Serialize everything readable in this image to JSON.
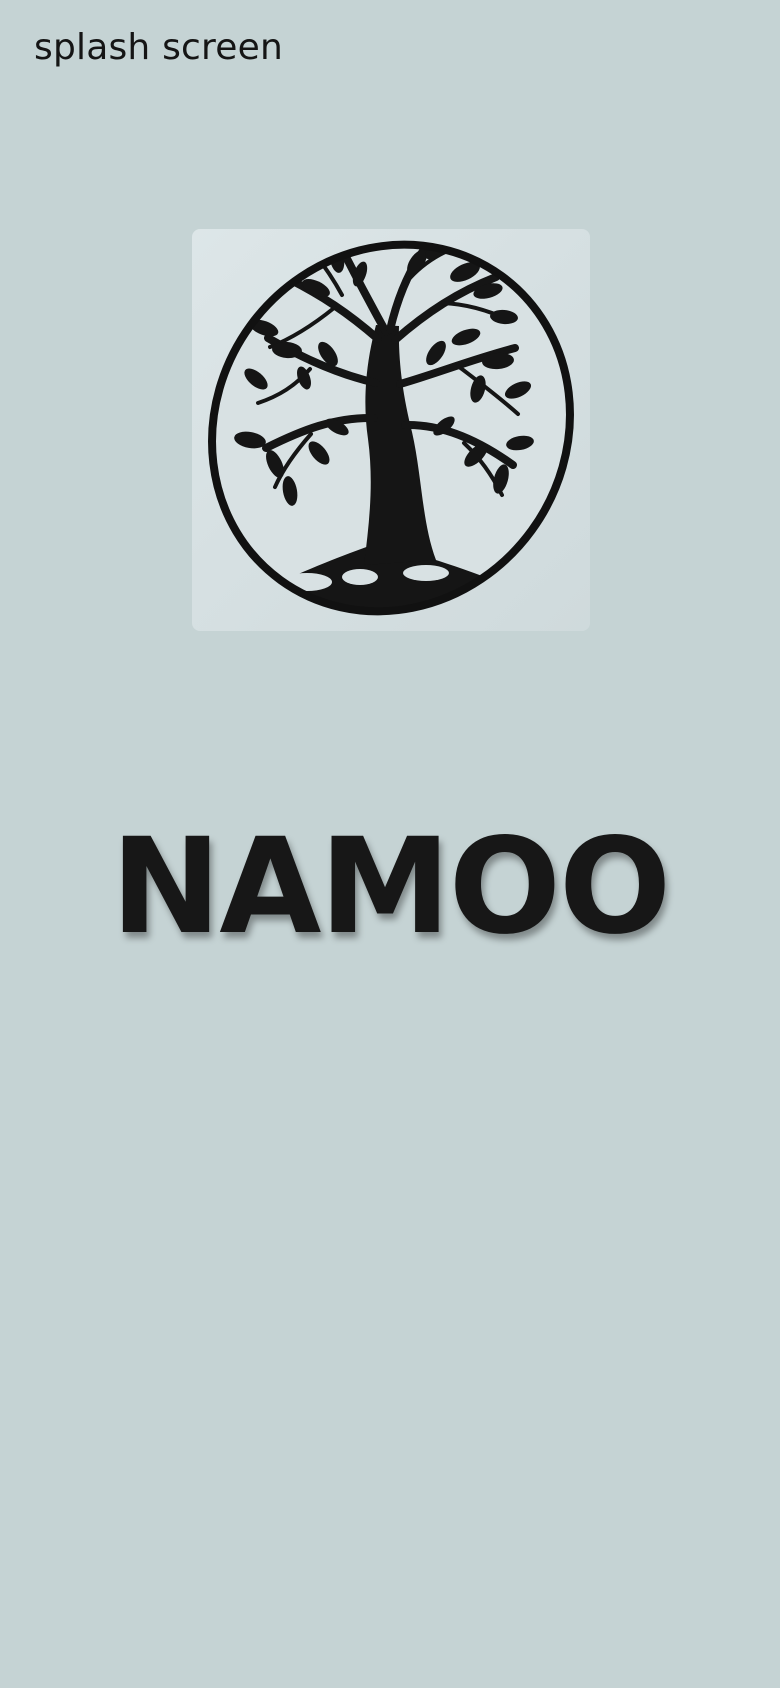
{
  "screen": {
    "label": "splash screen",
    "background_color": "#c5d3d4"
  },
  "logo": {
    "icon": "tree-of-life-icon",
    "color": "#111111"
  },
  "brand": {
    "title": "NAMOO",
    "color": "#171717"
  }
}
